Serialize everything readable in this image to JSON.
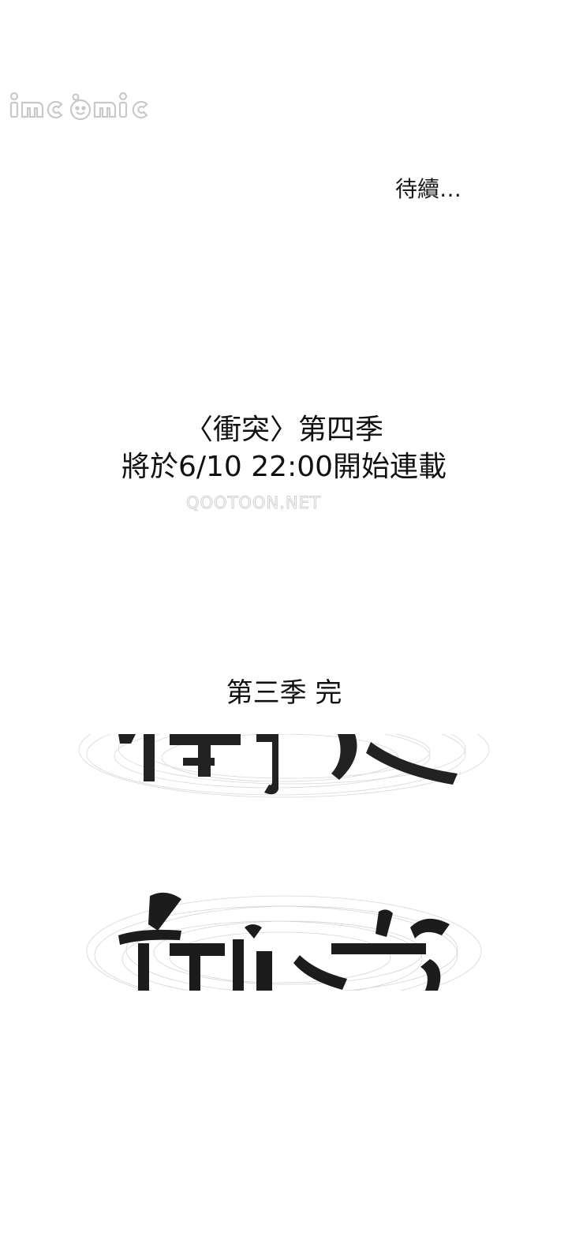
{
  "watermark": {
    "logo_text": "jmcomic",
    "site_text": "QOOTOON.NET"
  },
  "panel": {
    "to_be_continued": "待續…",
    "announcement_line1": "〈衝突〉第四季",
    "announcement_line2": "將於6/10 22:00開始連載",
    "season_end": "第三季 完"
  },
  "title_art": {
    "calligraphy_text": "衝突"
  },
  "colors": {
    "background": "#ffffff",
    "text": "#111111",
    "watermark_gray": "#c8c8c8"
  }
}
